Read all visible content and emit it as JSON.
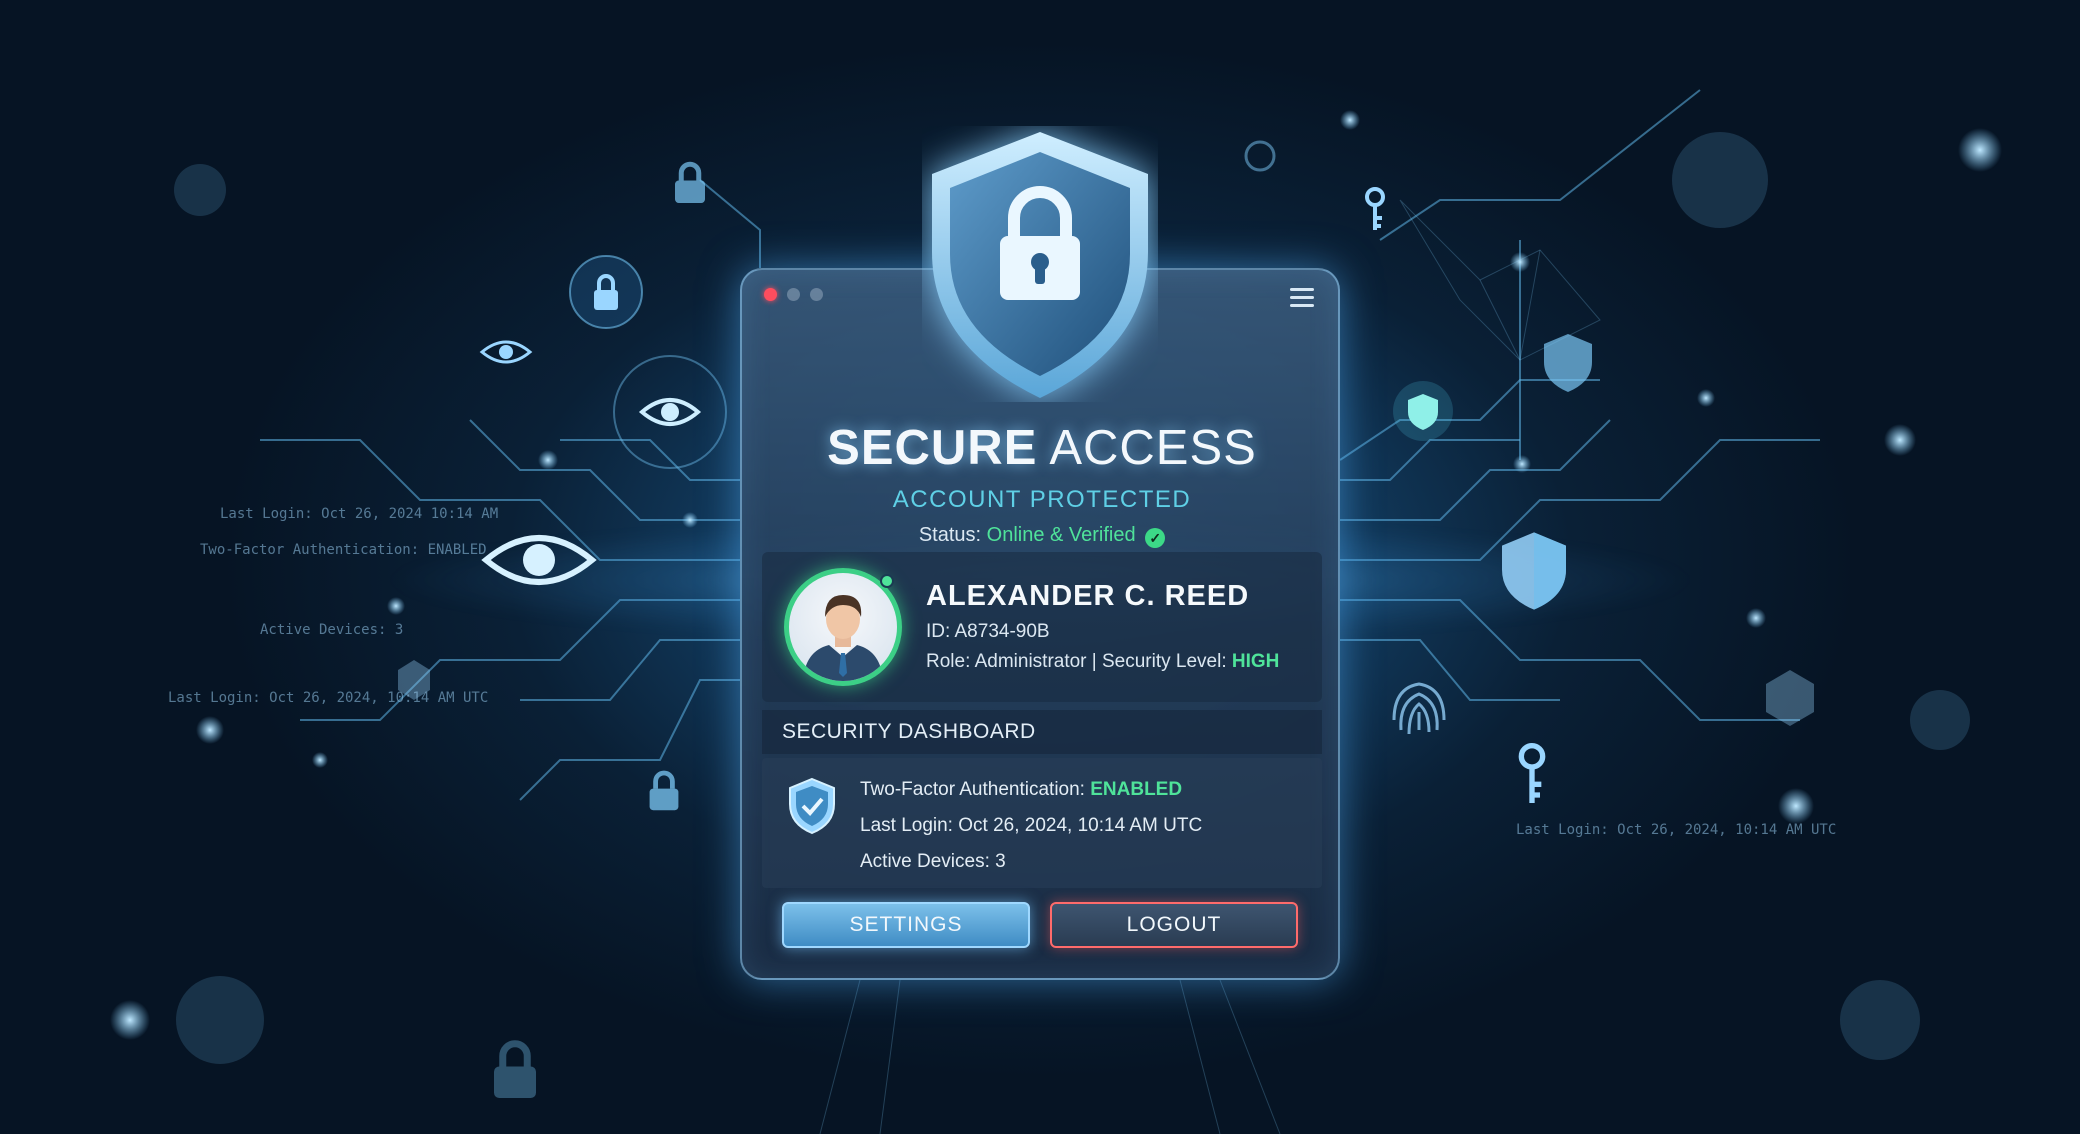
{
  "app": {
    "title_bold": "SECURE",
    "title_light": "ACCESS",
    "subtitle": "ACCOUNT PROTECTED",
    "status_label": "Status:",
    "status_value": "Online & Verified"
  },
  "user": {
    "name": "ALEXANDER C. REED",
    "id_line": "ID: A8734-90B",
    "role_line": "Role: Administrator | Security Level:",
    "security_level": "HIGH"
  },
  "dashboard": {
    "header": "SECURITY DASHBOARD",
    "two_factor_label": "Two-Factor Authentication:",
    "two_factor_value": "ENABLED",
    "last_login": "Last Login: Oct 26, 2024, 10:14 AM UTC",
    "active_devices": "Active Devices: 3"
  },
  "buttons": {
    "settings": "SETTINGS",
    "logout": "LOGOUT"
  },
  "background_text": {
    "left_last_login": "Last Login: Oct 26, 2024, 10:14 AM UTC",
    "right_last_login": "Last Login:  Oct 26, 2024, 10:14 AM UTC",
    "left_line_1": "Last Login: Oct 26, 2024 10:14 AM",
    "left_line_2": "Two-Factor Authentication: ENABLED",
    "left_line_3": "Active Devices: 3"
  },
  "colors": {
    "accent_green": "#4fe39a",
    "accent_cyan": "#5fd0e6",
    "logout_border": "#ff6b6b",
    "settings_fill": "#5aa6d8"
  },
  "icons": [
    "shield-lock-icon",
    "lock-icon",
    "eye-icon",
    "fingerprint-icon",
    "key-icon",
    "shield-icon",
    "menu-icon",
    "check-icon"
  ]
}
